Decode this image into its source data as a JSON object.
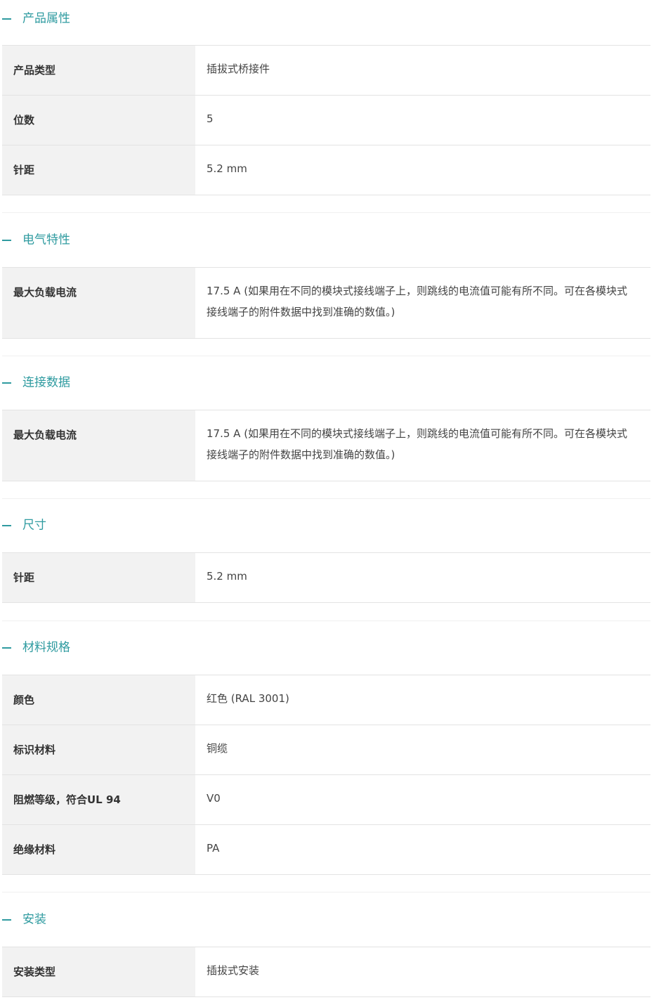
{
  "sections": [
    {
      "title": "产品属性",
      "rows": [
        {
          "label": "产品类型",
          "value": "插拔式桥接件"
        },
        {
          "label": "位数",
          "value": "5"
        },
        {
          "label": "针距",
          "value": "5.2 mm"
        }
      ]
    },
    {
      "title": "电气特性",
      "rows": [
        {
          "label": "最大负载电流",
          "value": "17.5 A (如果用在不同的模块式接线端子上，则跳线的电流值可能有所不同。可在各模块式接线端子的附件数据中找到准确的数值。)"
        }
      ]
    },
    {
      "title": "连接数据",
      "rows": [
        {
          "label": "最大负载电流",
          "value": "17.5 A (如果用在不同的模块式接线端子上，则跳线的电流值可能有所不同。可在各模块式接线端子的附件数据中找到准确的数值。)"
        }
      ]
    },
    {
      "title": "尺寸",
      "rows": [
        {
          "label": "针距",
          "value": "5.2 mm"
        }
      ]
    },
    {
      "title": "材料规格",
      "rows": [
        {
          "label": "颜色",
          "value": "红色 (RAL 3001)"
        },
        {
          "label": "标识材料",
          "value": "铜缆"
        },
        {
          "label": "阻燃等级，符合UL 94",
          "value": "V0"
        },
        {
          "label": "绝缘材料",
          "value": "PA"
        }
      ]
    },
    {
      "title": "安装",
      "rows": [
        {
          "label": "安装类型",
          "value": "插拔式安装"
        }
      ]
    }
  ],
  "colors": {
    "accent": "#2f9ba0",
    "label_bg": "#f2f2f2",
    "border": "#e3e3e3"
  },
  "icons": {
    "section_toggle": "minus-icon"
  }
}
